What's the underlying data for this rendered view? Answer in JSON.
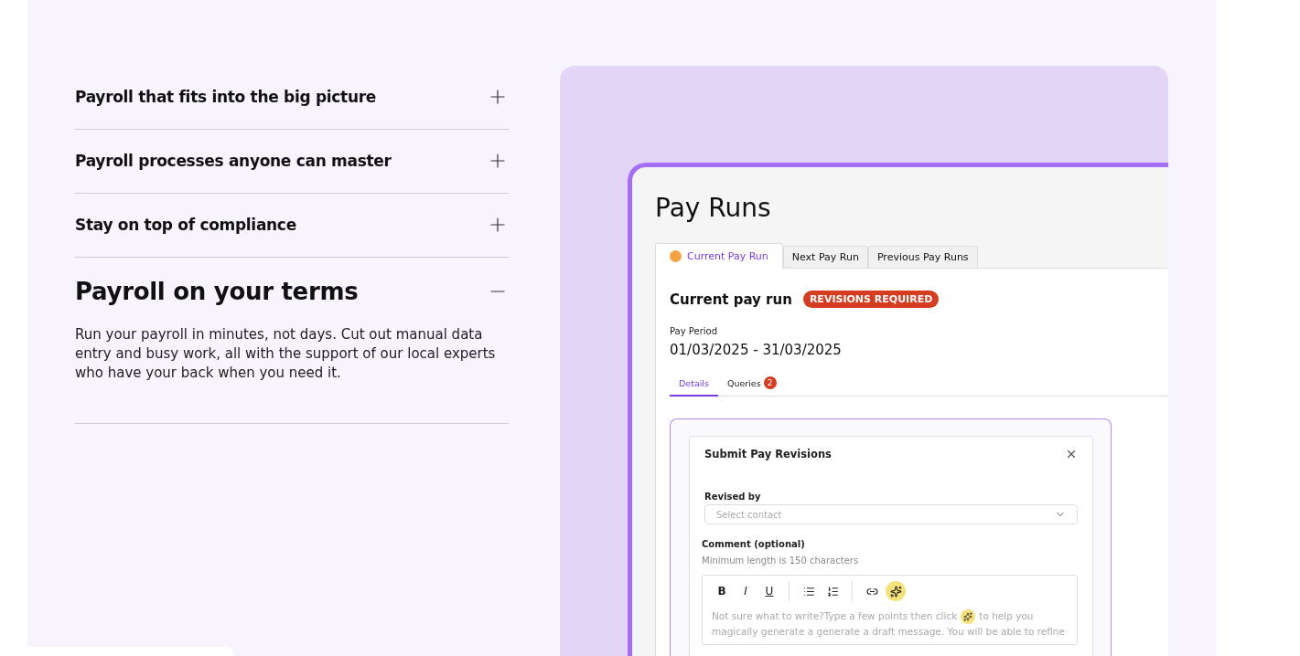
{
  "accordion": [
    {
      "title": "Payroll that fits into the big picture",
      "expanded": false
    },
    {
      "title": "Payroll processes anyone can master",
      "expanded": false
    },
    {
      "title": "Stay on top of compliance",
      "expanded": false
    },
    {
      "title": "Payroll on your terms",
      "expanded": true,
      "body": "Run your payroll in minutes, not days. Cut out manual data entry and busy work, all with the support of our local experts who have your back when you need it."
    }
  ],
  "app": {
    "title": "Pay Runs",
    "tabs": [
      {
        "label": "Current Pay Run",
        "selected": true,
        "alert": true
      },
      {
        "label": "Next Pay Run",
        "selected": false,
        "alert": false
      },
      {
        "label": "Previous Pay Runs",
        "selected": false,
        "alert": false
      }
    ],
    "heading": "Current pay run",
    "status_badge": "REVISIONS REQUIRED",
    "period_label": "Pay Period",
    "period_value": "01/03/2025 - 31/03/2025",
    "subtabs": [
      {
        "label": "Details",
        "selected": true
      },
      {
        "label": "Queries",
        "selected": false,
        "count": "2"
      }
    ],
    "dialog": {
      "title": "Submit Pay Revisions",
      "revised_by_label": "Revised by",
      "revised_by_placeholder": "Select contact",
      "comment_label": "Comment (optional)",
      "comment_hint": "Minimum length is 150 characters",
      "toolbar": [
        {
          "kind": "bold",
          "label": "B"
        },
        {
          "kind": "italic",
          "label": "I"
        },
        {
          "kind": "underline",
          "label": "U"
        },
        {
          "kind": "bullets"
        },
        {
          "kind": "numbers"
        },
        {
          "kind": "link"
        },
        {
          "kind": "magic",
          "highlighted": true
        }
      ],
      "editor_placeholder_before": "Not sure what to write?Type a few points then click",
      "editor_placeholder_after": "to help you magically generate a generate a draft message. You will be able to refine"
    }
  }
}
